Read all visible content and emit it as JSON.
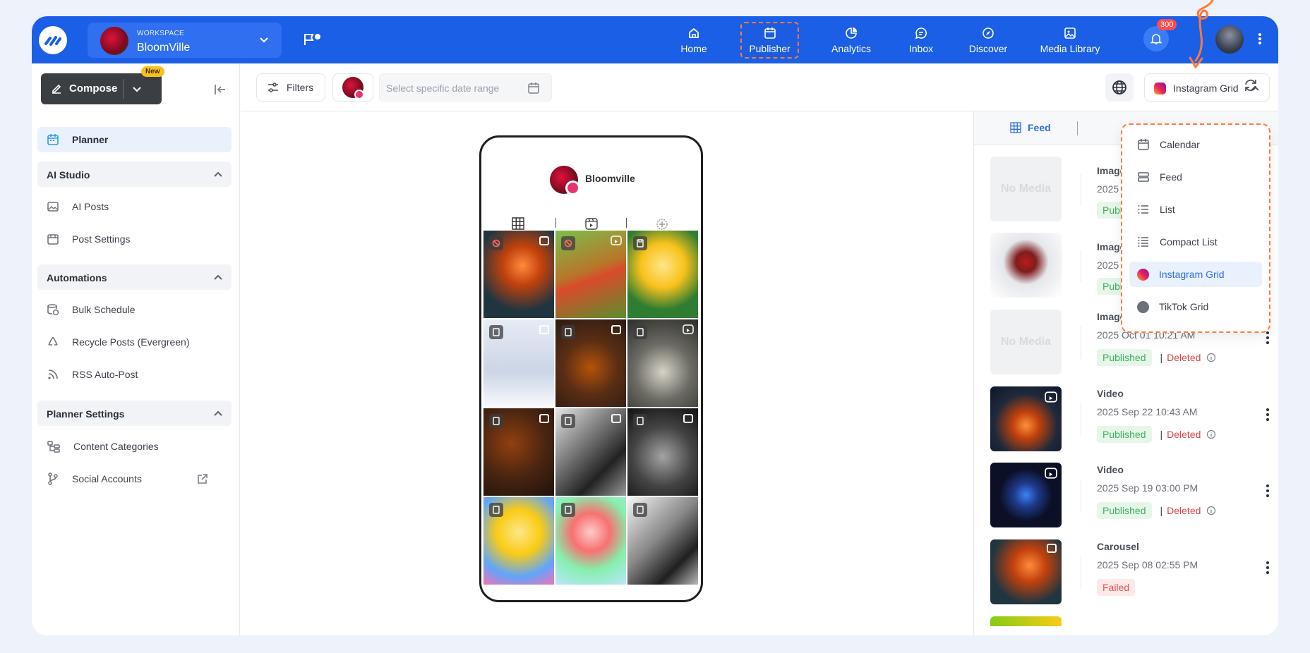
{
  "topbar": {
    "workspace_label": "WORKSPACE",
    "workspace_name": "BloomVille",
    "nav": [
      {
        "label": "Home",
        "icon": "home-icon"
      },
      {
        "label": "Publisher",
        "icon": "calendar-icon",
        "active": true
      },
      {
        "label": "Analytics",
        "icon": "pie-chart-icon"
      },
      {
        "label": "Inbox",
        "icon": "chat-bubble-icon"
      },
      {
        "label": "Discover",
        "icon": "compass-icon"
      },
      {
        "label": "Media Library",
        "icon": "image-stack-icon"
      }
    ],
    "notifications": "300",
    "accent": "#1a5fe6"
  },
  "sidebar": {
    "compose_label": "Compose",
    "new_badge": "New",
    "planner": "Planner",
    "ai_studio": {
      "title": "AI Studio",
      "items": [
        "AI Posts",
        "Post Settings"
      ]
    },
    "automations": {
      "title": "Automations",
      "items": [
        "Bulk Schedule",
        "Recycle Posts (Evergreen)",
        "RSS Auto-Post"
      ]
    },
    "planner_settings": {
      "title": "Planner Settings",
      "items": [
        "Content Categories",
        "Social Accounts"
      ]
    }
  },
  "toolbar": {
    "filters": "Filters",
    "date_placeholder": "Select specific date range",
    "view_selected": "Instagram Grid"
  },
  "phone": {
    "profile_name": "Bloomville"
  },
  "panel": {
    "tab_feed": "Feed",
    "posts": [
      {
        "type": "Image",
        "date": "2025 ...",
        "status": "Published",
        "media": "No Media"
      },
      {
        "type": "Image",
        "date": "2025 ...",
        "status": "Published",
        "media": "image"
      },
      {
        "type": "Image",
        "date": "2025 Oct 01 10:21 AM",
        "status": "Published",
        "deleted": "Deleted",
        "media": "No Media"
      },
      {
        "type": "Video",
        "date": "2025 Sep 22 10:43 AM",
        "status": "Published",
        "deleted": "Deleted",
        "media": "video"
      },
      {
        "type": "Video",
        "date": "2025 Sep 19 03:00 PM",
        "status": "Published",
        "deleted": "Deleted",
        "media": "video"
      },
      {
        "type": "Carousel",
        "date": "2025 Sep 08 02:55 PM",
        "status": "Failed",
        "media": "carousel"
      }
    ]
  },
  "dropdown": {
    "items": [
      {
        "label": "Calendar",
        "icon": "calendar-icon"
      },
      {
        "label": "Feed",
        "icon": "feed-icon"
      },
      {
        "label": "List",
        "icon": "list-icon"
      },
      {
        "label": "Compact List",
        "icon": "compact-list-icon"
      },
      {
        "label": "Instagram Grid",
        "icon": "instagram-icon",
        "selected": true
      },
      {
        "label": "TikTok Grid",
        "icon": "tiktok-icon"
      }
    ]
  },
  "colors": {
    "accent": "#1a5fe6",
    "highlight": "#ff7a3c",
    "published": "#3fae5a",
    "deleted": "#d64545"
  }
}
